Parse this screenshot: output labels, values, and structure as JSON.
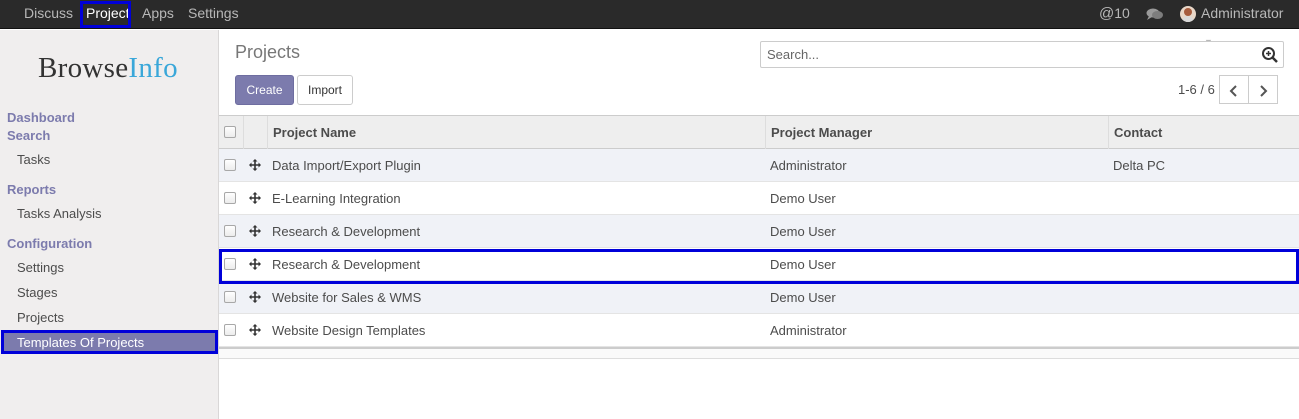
{
  "topbar": {
    "menus": [
      "Discuss",
      "Project",
      "Apps",
      "Settings"
    ],
    "mentions_count": "10",
    "user_name": "Administrator"
  },
  "sidebar": {
    "logo_part1": "Browse",
    "logo_part2": "Info",
    "sections": [
      {
        "title": "Dashboard"
      },
      {
        "title": "Search",
        "items": [
          "Tasks"
        ]
      },
      {
        "title": "Reports",
        "items": [
          "Tasks Analysis"
        ]
      },
      {
        "title": "Configuration",
        "items": [
          "Settings",
          "Stages",
          "Projects",
          "Templates Of Projects"
        ]
      }
    ]
  },
  "control_panel": {
    "title": "Projects",
    "search_placeholder": "Search...",
    "create_label": "Create",
    "import_label": "Import",
    "pager_value": "1-6 / 6"
  },
  "list": {
    "columns": [
      "Project Name",
      "Project Manager",
      "Contact"
    ],
    "rows": [
      {
        "name": "Data Import/Export Plugin",
        "manager": "Administrator",
        "contact": "Delta PC"
      },
      {
        "name": "E-Learning Integration",
        "manager": "Demo User",
        "contact": ""
      },
      {
        "name": "Research & Development",
        "manager": "Demo User",
        "contact": ""
      },
      {
        "name": "Research & Development",
        "manager": "Demo User",
        "contact": ""
      },
      {
        "name": "Website for Sales & WMS",
        "manager": "Demo User",
        "contact": ""
      },
      {
        "name": "Website Design Templates",
        "manager": "Administrator",
        "contact": ""
      }
    ]
  },
  "colors": {
    "accent": "#7c7bad",
    "highlight_border": "#0000d9",
    "topbar_bg": "#2a2a2a"
  }
}
